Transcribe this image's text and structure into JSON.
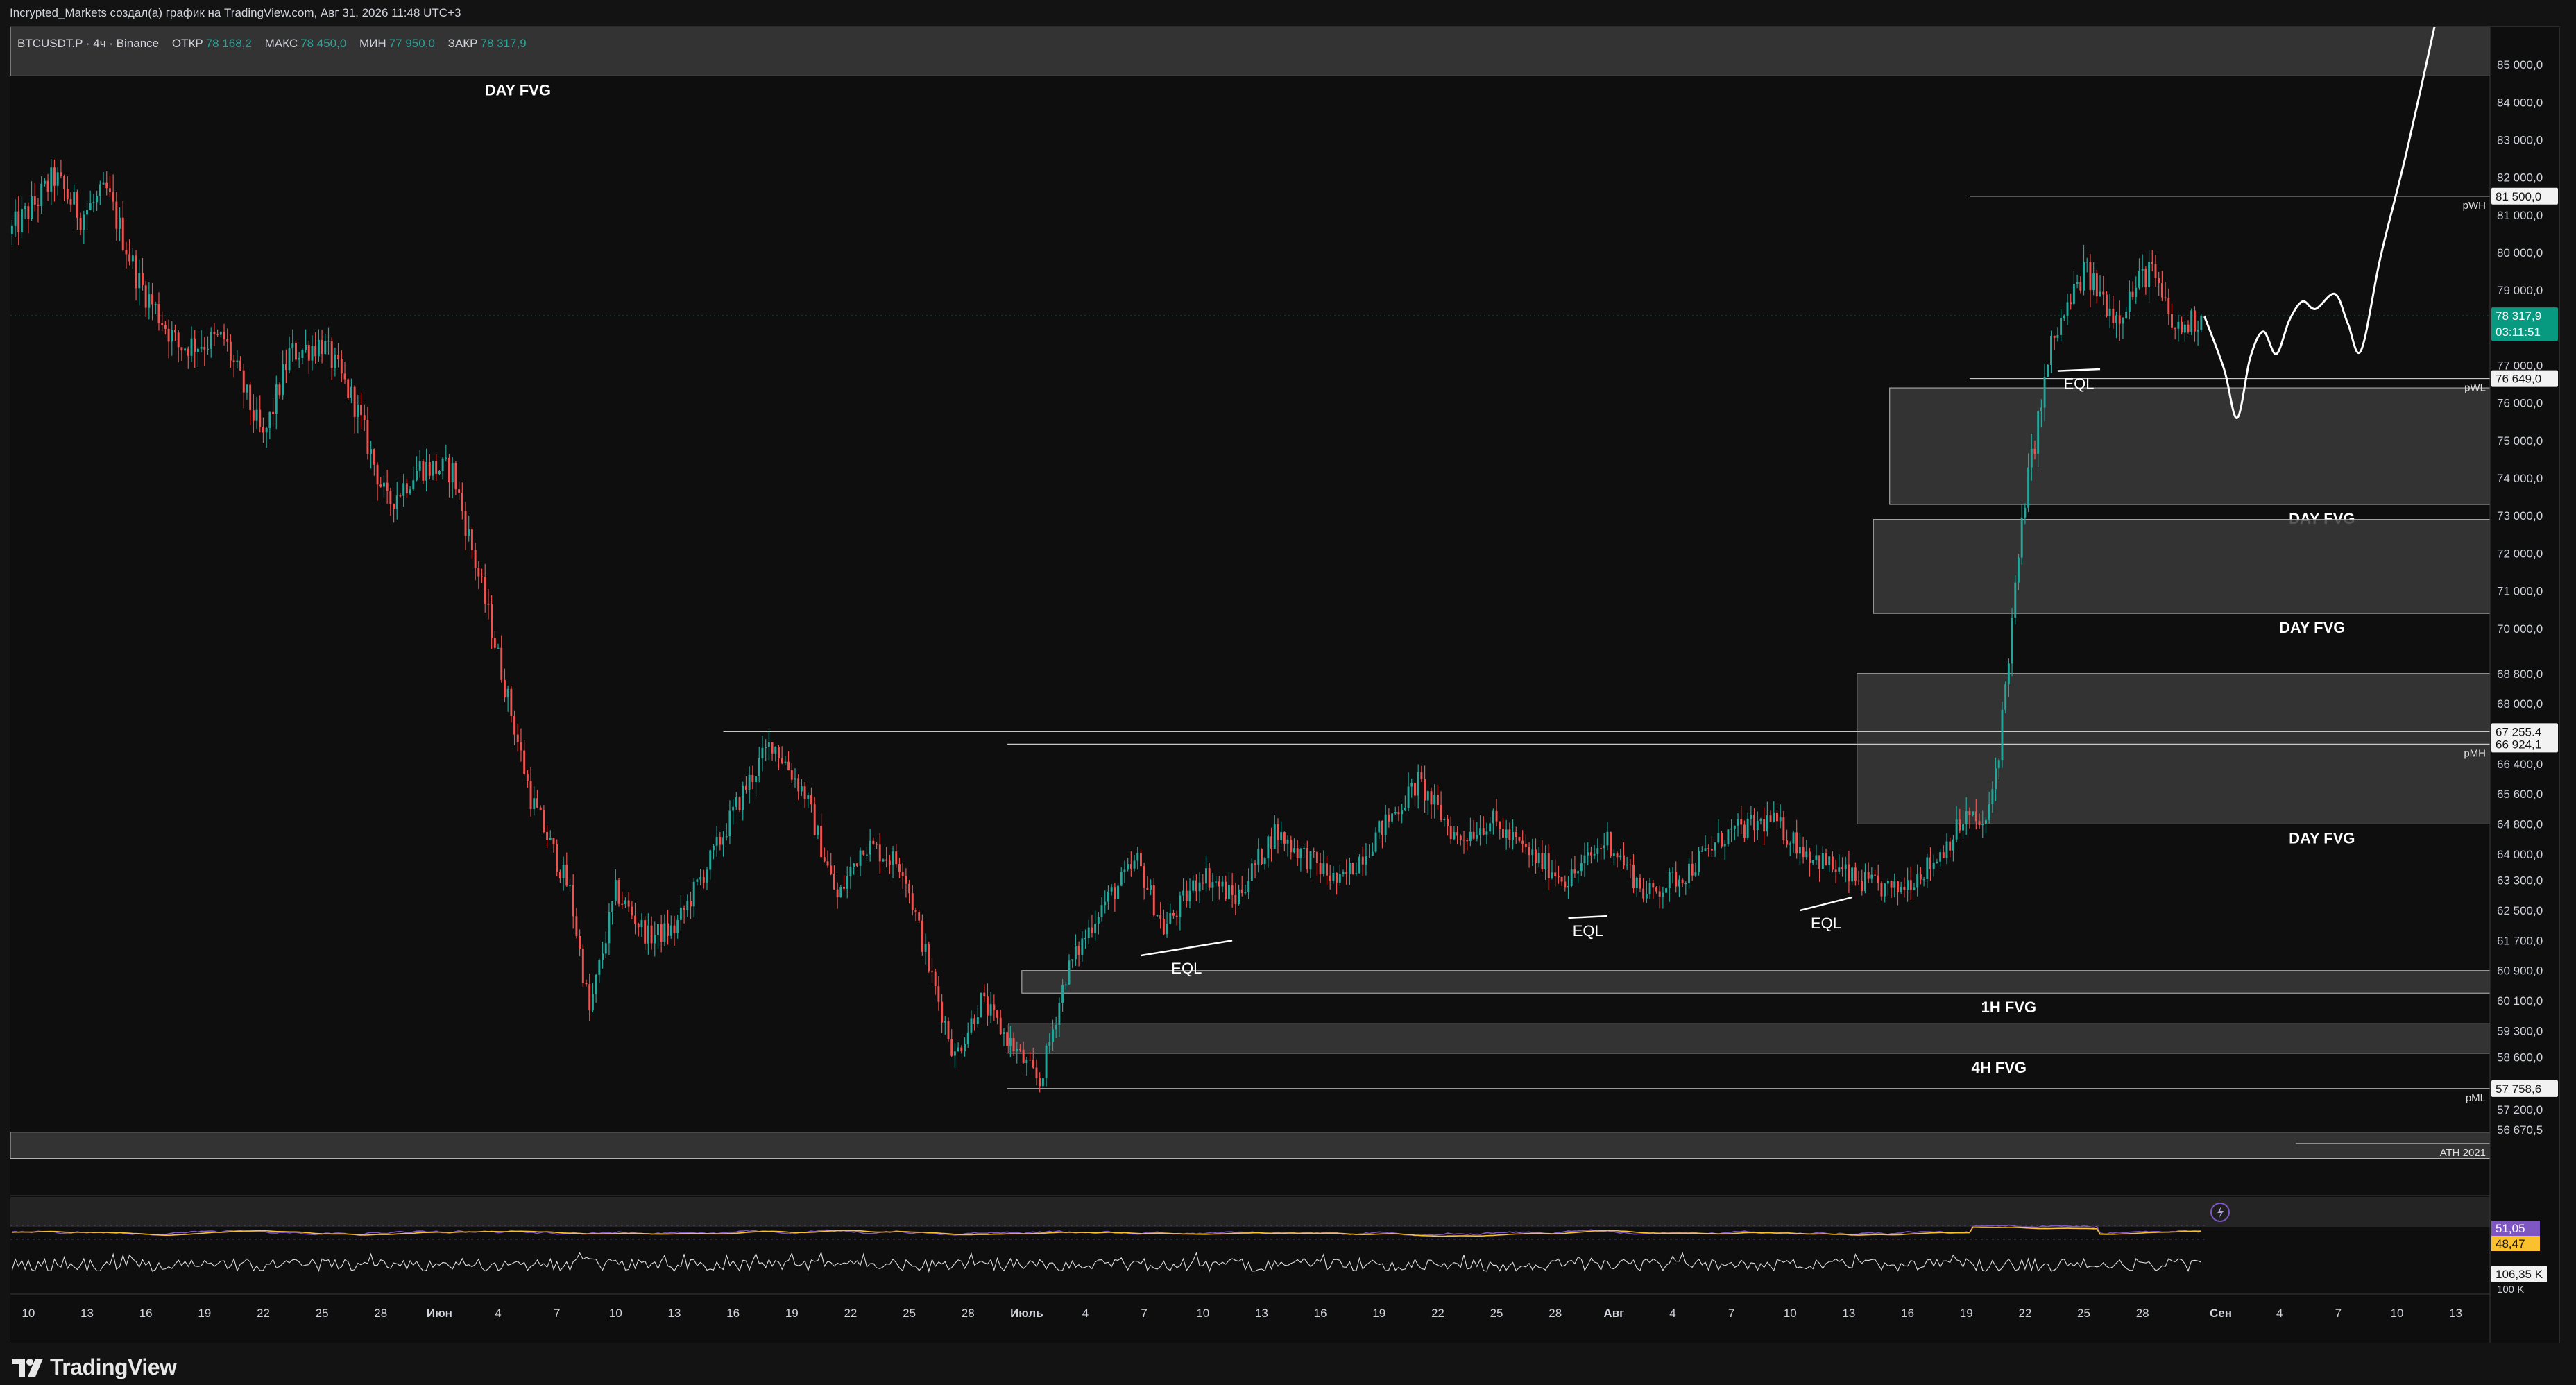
{
  "header": {
    "attribution": "Incrypted_Markets создал(а) график на TradingView.com, Авг 31, 2026 11:48 UTC+3"
  },
  "legend": {
    "symbol": "BTCUSDT.P · 4ч · Binance",
    "open_label": "ОТКР",
    "open_value": "78 168,2",
    "high_label": "МАКС",
    "high_value": "78 450,0",
    "low_label": "МИН",
    "low_value": "77 950,0",
    "close_label": "ЗАКР",
    "close_value": "78 317,9"
  },
  "brand": {
    "name": "TradingView"
  },
  "colors": {
    "up": "#26a69a",
    "down": "#ef5350",
    "zone_fill": "#3a3a3a",
    "price_tag": "#089981",
    "oscillator_fast": "#7e57c2",
    "oscillator_slow": "#fbc02d"
  },
  "chart_data": {
    "type": "candlestick",
    "symbol": "BTCUSDT.P",
    "timeframe": "4ч",
    "exchange": "Binance",
    "ylim": [
      55800,
      86000
    ],
    "y_ticks": [
      {
        "v": 85000,
        "label": "85 000,0"
      },
      {
        "v": 84000,
        "label": "84 000,0"
      },
      {
        "v": 83000,
        "label": "83 000,0"
      },
      {
        "v": 82000,
        "label": "82 000,0"
      },
      {
        "v": 81000,
        "label": "81 000,0"
      },
      {
        "v": 80000,
        "label": "80 000,0"
      },
      {
        "v": 79000,
        "label": "79 000,0"
      },
      {
        "v": 77000,
        "label": "77 000,0"
      },
      {
        "v": 76000,
        "label": "76 000,0"
      },
      {
        "v": 75000,
        "label": "75 000,0"
      },
      {
        "v": 74000,
        "label": "74 000,0"
      },
      {
        "v": 73000,
        "label": "73 000,0"
      },
      {
        "v": 72000,
        "label": "72 000,0"
      },
      {
        "v": 71000,
        "label": "71 000,0"
      },
      {
        "v": 70000,
        "label": "70 000,0"
      },
      {
        "v": 68800,
        "label": "68 800,0"
      },
      {
        "v": 68000,
        "label": "68 000,0"
      },
      {
        "v": 66400,
        "label": "66 400,0"
      },
      {
        "v": 65600,
        "label": "65 600,0"
      },
      {
        "v": 64800,
        "label": "64 800,0"
      },
      {
        "v": 64000,
        "label": "64 000,0"
      },
      {
        "v": 63300,
        "label": "63 300,0"
      },
      {
        "v": 62500,
        "label": "62 500,0"
      },
      {
        "v": 61700,
        "label": "61 700,0"
      },
      {
        "v": 60900,
        "label": "60 900,0"
      },
      {
        "v": 60100,
        "label": "60 100,0"
      },
      {
        "v": 59300,
        "label": "59 300,0"
      },
      {
        "v": 58600,
        "label": "58 600,0"
      },
      {
        "v": 57200,
        "label": "57 200,0"
      },
      {
        "v": 56670.5,
        "label": "56 670,5"
      }
    ],
    "price_tags": [
      {
        "v": 81500,
        "label": "81 500,0",
        "style": "light"
      },
      {
        "v": 78317.9,
        "label": "78 317,9",
        "sub": "03:11:51",
        "style": "current"
      },
      {
        "v": 76649,
        "label": "76 649,0",
        "style": "light"
      },
      {
        "v": 67255.4,
        "label": "67 255,4",
        "style": "light"
      },
      {
        "v": 66924.1,
        "label": "66 924,1",
        "style": "light"
      },
      {
        "v": 57758.6,
        "label": "57 758,6",
        "style": "light"
      }
    ],
    "x_ticks": [
      {
        "i": 5,
        "label": "10"
      },
      {
        "i": 23,
        "label": "13"
      },
      {
        "i": 41,
        "label": "16"
      },
      {
        "i": 59,
        "label": "19"
      },
      {
        "i": 77,
        "label": "22"
      },
      {
        "i": 95,
        "label": "25"
      },
      {
        "i": 113,
        "label": "28"
      },
      {
        "i": 131,
        "label": "Июн",
        "bold": true
      },
      {
        "i": 149,
        "label": "4"
      },
      {
        "i": 167,
        "label": "7"
      },
      {
        "i": 185,
        "label": "10"
      },
      {
        "i": 203,
        "label": "13"
      },
      {
        "i": 221,
        "label": "16"
      },
      {
        "i": 239,
        "label": "19"
      },
      {
        "i": 257,
        "label": "22"
      },
      {
        "i": 275,
        "label": "25"
      },
      {
        "i": 293,
        "label": "28"
      },
      {
        "i": 311,
        "label": "Июль",
        "bold": true
      },
      {
        "i": 329,
        "label": "4"
      },
      {
        "i": 347,
        "label": "7"
      },
      {
        "i": 365,
        "label": "10"
      },
      {
        "i": 383,
        "label": "13"
      },
      {
        "i": 401,
        "label": "16"
      },
      {
        "i": 419,
        "label": "19"
      },
      {
        "i": 437,
        "label": "22"
      },
      {
        "i": 455,
        "label": "25"
      },
      {
        "i": 473,
        "label": "28"
      },
      {
        "i": 491,
        "label": "Авг",
        "bold": true
      },
      {
        "i": 509,
        "label": "4"
      },
      {
        "i": 527,
        "label": "7"
      },
      {
        "i": 545,
        "label": "10"
      },
      {
        "i": 563,
        "label": "13"
      },
      {
        "i": 581,
        "label": "16"
      },
      {
        "i": 599,
        "label": "19"
      },
      {
        "i": 617,
        "label": "22"
      },
      {
        "i": 635,
        "label": "25"
      },
      {
        "i": 653,
        "label": "28"
      },
      {
        "i": 677,
        "label": "Сен",
        "bold": true
      },
      {
        "i": 695,
        "label": "4"
      },
      {
        "i": 713,
        "label": "7"
      },
      {
        "i": 731,
        "label": "10"
      },
      {
        "i": 749,
        "label": "13"
      }
    ],
    "n_slots": 760,
    "anchors": [
      [
        0,
        80500
      ],
      [
        8,
        81300
      ],
      [
        14,
        82000
      ],
      [
        22,
        81000
      ],
      [
        30,
        81600
      ],
      [
        40,
        79200
      ],
      [
        52,
        77500
      ],
      [
        66,
        77700
      ],
      [
        78,
        75000
      ],
      [
        86,
        77300
      ],
      [
        96,
        77600
      ],
      [
        106,
        76000
      ],
      [
        116,
        73300
      ],
      [
        126,
        74300
      ],
      [
        136,
        74200
      ],
      [
        148,
        70000
      ],
      [
        160,
        65500
      ],
      [
        172,
        63000
      ],
      [
        178,
        59800
      ],
      [
        186,
        63000
      ],
      [
        196,
        61800
      ],
      [
        204,
        62000
      ],
      [
        216,
        64000
      ],
      [
        226,
        65800
      ],
      [
        234,
        67000
      ],
      [
        244,
        65600
      ],
      [
        254,
        62800
      ],
      [
        262,
        64300
      ],
      [
        274,
        63700
      ],
      [
        282,
        61000
      ],
      [
        290,
        58600
      ],
      [
        298,
        60100
      ],
      [
        306,
        59100
      ],
      [
        316,
        57900
      ],
      [
        324,
        60800
      ],
      [
        334,
        62500
      ],
      [
        346,
        63800
      ],
      [
        354,
        62000
      ],
      [
        366,
        63500
      ],
      [
        376,
        62800
      ],
      [
        388,
        64600
      ],
      [
        398,
        63900
      ],
      [
        408,
        63200
      ],
      [
        420,
        64600
      ],
      [
        432,
        65900
      ],
      [
        444,
        64400
      ],
      [
        454,
        64900
      ],
      [
        466,
        64000
      ],
      [
        478,
        63300
      ],
      [
        490,
        64400
      ],
      [
        502,
        62900
      ],
      [
        514,
        63500
      ],
      [
        526,
        64500
      ],
      [
        540,
        64900
      ],
      [
        552,
        64000
      ],
      [
        566,
        63300
      ],
      [
        578,
        63000
      ],
      [
        590,
        63800
      ],
      [
        600,
        65000
      ],
      [
        606,
        64700
      ],
      [
        610,
        66800
      ],
      [
        618,
        73500
      ],
      [
        626,
        77500
      ],
      [
        636,
        79500
      ],
      [
        646,
        78300
      ],
      [
        656,
        79600
      ],
      [
        664,
        77900
      ],
      [
        672,
        78300
      ]
    ],
    "candle_count": 672,
    "projection": [
      [
        672,
        78300
      ],
      [
        678,
        76900
      ],
      [
        682,
        75600
      ],
      [
        686,
        77200
      ],
      [
        690,
        77900
      ],
      [
        694,
        77300
      ],
      [
        698,
        78200
      ],
      [
        702,
        78700
      ],
      [
        706,
        78500
      ],
      [
        712,
        78900
      ],
      [
        716,
        78100
      ],
      [
        720,
        77400
      ],
      [
        726,
        79900
      ],
      [
        734,
        82700
      ],
      [
        744,
        86600
      ]
    ],
    "zones": [
      {
        "top": 86500,
        "bottom": 84700,
        "left_slot": 0,
        "label": "DAY FVG",
        "label_slot": 155,
        "label_side": "below"
      },
      {
        "top": 76400,
        "bottom": 73300,
        "left_slot": 576,
        "label": "DAY FVG",
        "label_slot": 708,
        "label_side": "below"
      },
      {
        "top": 72900,
        "bottom": 70400,
        "left_slot": 571,
        "label": "DAY FVG",
        "label_slot": 705,
        "label_side": "below"
      },
      {
        "top": 68800,
        "bottom": 64800,
        "left_slot": 566,
        "label": "DAY FVG",
        "label_slot": 708,
        "label_side": "below"
      },
      {
        "top": 60900,
        "bottom": 60300,
        "left_slot": 310,
        "label": "1H FVG",
        "label_slot": 612,
        "label_side": "below"
      },
      {
        "top": 59500,
        "bottom": 58700,
        "left_slot": 306,
        "label": "4H FVG",
        "label_slot": 609,
        "label_side": "below"
      },
      {
        "top": 56600,
        "bottom": 55900,
        "left_slot": 0,
        "label": "",
        "label_slot": 0,
        "label_side": "below"
      }
    ],
    "levels": [
      {
        "v": 81500,
        "from_slot": 600,
        "label": "pWH"
      },
      {
        "v": 76649,
        "from_slot": 600,
        "label": "pWL"
      },
      {
        "v": 67255.4,
        "from_slot": 218,
        "label": ""
      },
      {
        "v": 66924.1,
        "from_slot": 305,
        "label": "pMH"
      },
      {
        "v": 57758.6,
        "from_slot": 305,
        "label": "pML"
      },
      {
        "v": 56300,
        "from_slot": 700,
        "label": "ATH 2021"
      }
    ],
    "eql_marks": [
      {
        "x1": 346,
        "y1": 61300,
        "x2": 374,
        "y2": 61700,
        "label": "EQL"
      },
      {
        "x1": 477,
        "y1": 62300,
        "x2": 489,
        "y2": 62350,
        "label": "EQL"
      },
      {
        "x1": 548,
        "y1": 62500,
        "x2": 564,
        "y2": 62850,
        "label": "EQL"
      },
      {
        "x1": 627,
        "y1": 76850,
        "x2": 640,
        "y2": 76900,
        "label": "EQL"
      }
    ],
    "oscillator": {
      "labels": [
        "51,05",
        "48,47"
      ],
      "fast_color": "#7e57c2",
      "slow_color": "#fbc02d"
    },
    "volume_osc": {
      "labels": [
        "106,35 K",
        "100 K"
      ]
    }
  }
}
